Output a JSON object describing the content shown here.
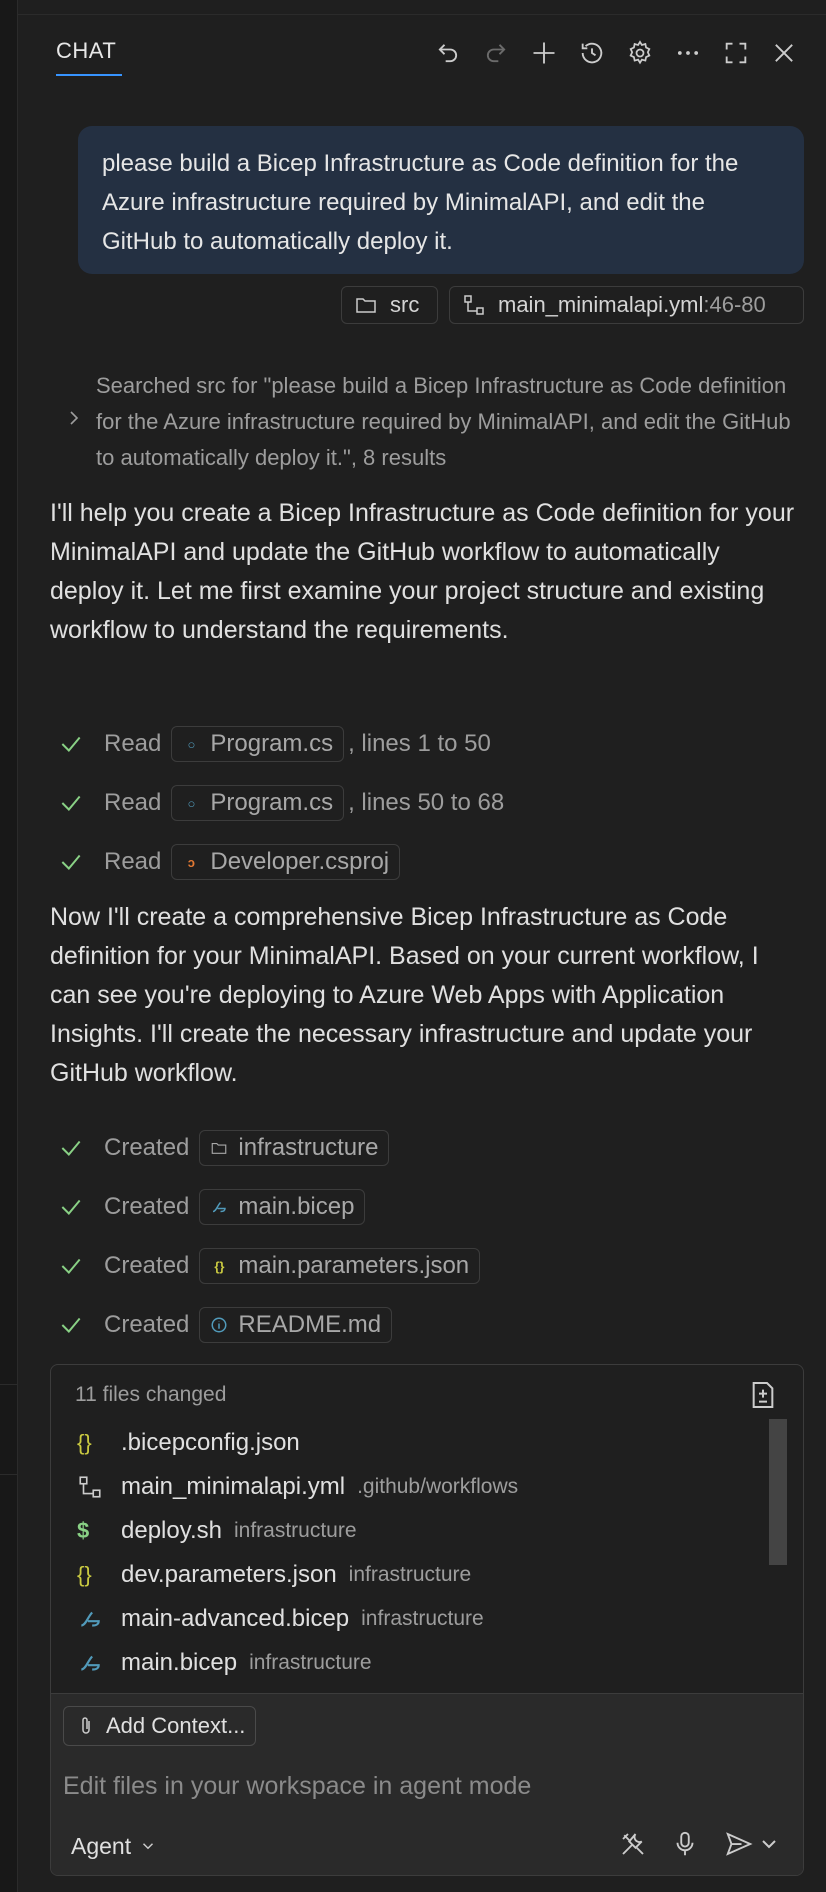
{
  "header": {
    "tab_label": "CHAT",
    "icons": [
      "undo-icon",
      "redo-icon",
      "new-chat-icon",
      "history-icon",
      "settings-icon",
      "more-icon",
      "maximize-icon",
      "close-icon"
    ]
  },
  "user_message": {
    "text": "please build a Bicep Infrastructure as Code definition for the Azure infrastructure required by MinimalAPI, and edit the GitHub to automatically deploy it.",
    "attachments": [
      {
        "label": "src",
        "suffix": "",
        "icon": "folder-icon"
      },
      {
        "label": "main_minimalapi.yml",
        "suffix": ":46-80",
        "icon": "workflow-icon"
      }
    ]
  },
  "search_summary": "Searched src for \"please build a Bicep Infrastructure as Code definition for the Azure infrastructure required by MinimalAPI, and edit the GitHub to automatically deploy it.\", 8 results",
  "response": {
    "paragraph1": "I'll help you create a Bicep Infrastructure as Code definition for your MinimalAPI and update the GitHub workflow to automatically deploy it. Let me first examine your project structure and existing workflow to understand the requirements.",
    "reads": [
      {
        "verb": "Read",
        "file": "Program.cs",
        "suffix": ", lines 1 to 50"
      },
      {
        "verb": "Read",
        "file": "Program.cs",
        "suffix": ", lines 50 to 68"
      },
      {
        "verb": "Read",
        "file": "Developer.csproj",
        "suffix": ""
      }
    ],
    "paragraph2": "Now I'll create a comprehensive Bicep Infrastructure as Code definition for your MinimalAPI. Based on your current workflow, I can see you're deploying to Azure Web Apps with Application Insights. I'll create the necessary infrastructure and update your GitHub workflow.",
    "creates": [
      {
        "verb": "Created",
        "file": "infrastructure"
      },
      {
        "verb": "Created",
        "file": "main.bicep"
      },
      {
        "verb": "Created",
        "file": "main.parameters.json"
      },
      {
        "verb": "Created",
        "file": "README.md"
      }
    ]
  },
  "files_changed": {
    "title": "11 files changed",
    "files": [
      {
        "name": ".bicepconfig.json",
        "dir": "",
        "icon": "json-icon"
      },
      {
        "name": "main_minimalapi.yml",
        "dir": ".github/workflows",
        "icon": "workflow-icon"
      },
      {
        "name": "deploy.sh",
        "dir": "infrastructure",
        "icon": "shell-icon"
      },
      {
        "name": "dev.parameters.json",
        "dir": "infrastructure",
        "icon": "json-icon"
      },
      {
        "name": "main-advanced.bicep",
        "dir": "infrastructure",
        "icon": "bicep-icon"
      },
      {
        "name": "main.bicep",
        "dir": "infrastructure",
        "icon": "bicep-icon"
      }
    ]
  },
  "input": {
    "add_context_label": "Add Context...",
    "placeholder": "Edit files in your workspace in agent mode",
    "mode_label": "Agent"
  },
  "colors": {
    "accent": "#3794ff",
    "check": "#89d185",
    "bubble": "#243042",
    "json_icon": "#cbcb41",
    "shell_icon": "#89d185",
    "bicep_icon": "#519aba",
    "rss_icon": "#e37933"
  }
}
